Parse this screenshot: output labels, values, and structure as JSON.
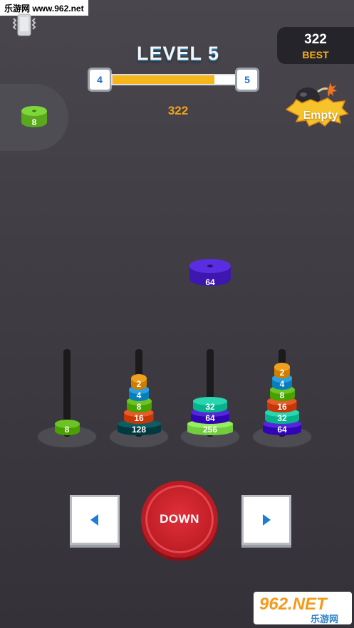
{
  "watermark_top": "乐游网 www.962.net",
  "hud": {
    "vibrate_icon": "vibrate-phone-icon",
    "best_score": "322",
    "best_label": "BEST",
    "level_title": "LEVEL 5",
    "level_current": "4",
    "level_next": "5",
    "level_progress": 0.83,
    "score": "322",
    "bomb_label": "Empty"
  },
  "held_ring": {
    "value": "8",
    "color": "#6cc324"
  },
  "falling_ring": {
    "value": "64",
    "color": "#5428d8"
  },
  "towers": [
    {
      "rings": [
        {
          "value": "8",
          "color": "#6cc324"
        }
      ]
    },
    {
      "rings": [
        {
          "value": "128",
          "color": "#0f5c63"
        },
        {
          "value": "16",
          "color": "#e85a2a"
        },
        {
          "value": "8",
          "color": "#6cc324"
        },
        {
          "value": "4",
          "color": "#2aa0e0"
        },
        {
          "value": "2",
          "color": "#f0a020"
        }
      ]
    },
    {
      "rings": [
        {
          "value": "256",
          "color": "#94f060"
        },
        {
          "value": "64",
          "color": "#5428d8"
        },
        {
          "value": "32",
          "color": "#2ad6b0"
        }
      ]
    },
    {
      "rings": [
        {
          "value": "64",
          "color": "#5428d8"
        },
        {
          "value": "32",
          "color": "#2ad6b0"
        },
        {
          "value": "16",
          "color": "#e85a2a"
        },
        {
          "value": "8",
          "color": "#6cc324"
        },
        {
          "value": "4",
          "color": "#2aa0e0"
        },
        {
          "value": "2",
          "color": "#f0a020"
        }
      ]
    }
  ],
  "controls": {
    "left_icon": "left-arrow-icon",
    "down_label": "DOWN",
    "right_icon": "right-arrow-icon"
  },
  "watermark_bottom": {
    "brand": "962.NET",
    "sub": "乐游网"
  }
}
